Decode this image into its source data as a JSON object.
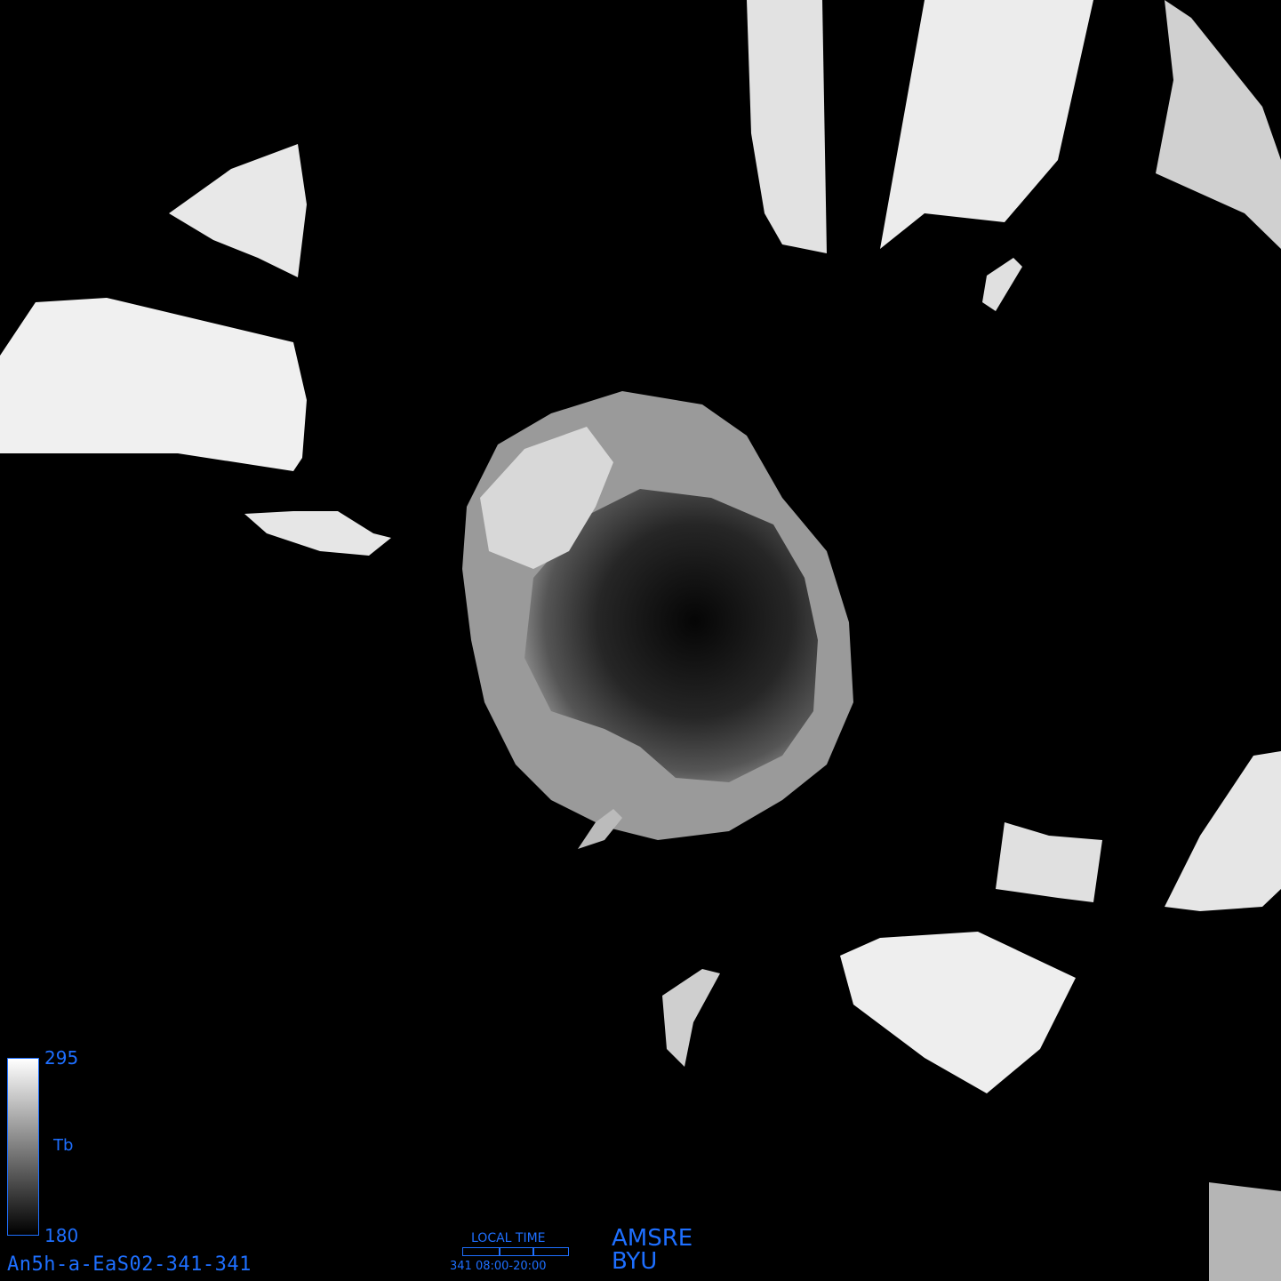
{
  "colorbar": {
    "max_label": "295",
    "min_label": "180",
    "variable": "Tb"
  },
  "image_id": "An5h-a-EaS02-341-341",
  "local_time": {
    "title": "LOCAL TIME",
    "day_range": "341 08:00-20:00"
  },
  "sensor": {
    "line1": "AMSRE",
    "line2": "BYU"
  },
  "colors": {
    "annotation": "#1e6fff",
    "background": "#000000"
  }
}
